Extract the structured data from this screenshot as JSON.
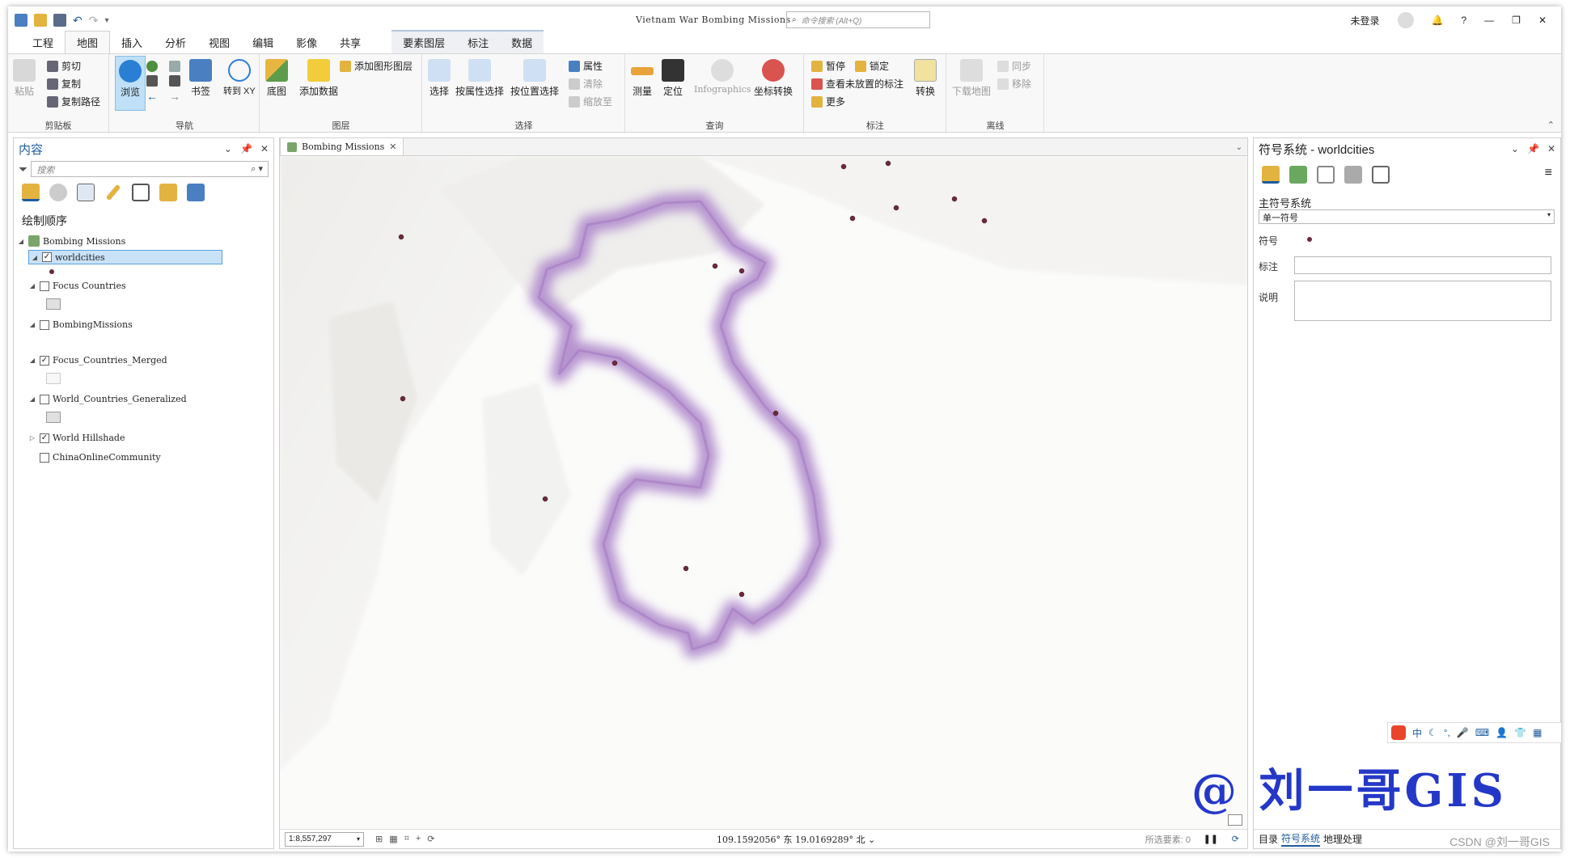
{
  "window": {
    "title": "Vietnam War Bombing Missions",
    "command_search_placeholder": "命令搜索 (Alt+Q)",
    "user_status": "未登录",
    "help": "?"
  },
  "ribbon_tabs": [
    "工程",
    "地图",
    "插入",
    "分析",
    "视图",
    "编辑",
    "影像",
    "共享"
  ],
  "active_tab": "地图",
  "context_tabs": [
    "要素图层",
    "标注",
    "数据"
  ],
  "ribbon": {
    "clipboard": {
      "label": "剪贴板",
      "paste": "粘贴",
      "cut": "剪切",
      "copy": "复制",
      "copy_path": "复制路径"
    },
    "navigate": {
      "label": "导航",
      "explore": "浏览",
      "bookmarks": "书签",
      "goto_xy": "转到 XY"
    },
    "layer": {
      "label": "图层",
      "basemap": "底图",
      "add_data": "添加数据",
      "add_graphics_layer": "添加图形图层"
    },
    "selection": {
      "label": "选择",
      "select": "选择",
      "select_by_attributes": "按属性选择",
      "select_by_location": "按位置选择",
      "attributes": "属性",
      "clear": "清除",
      "zoom_to": "缩放至"
    },
    "inquiry": {
      "label": "查询",
      "measure": "测量",
      "locate": "定位",
      "infographics": "Infographics",
      "coordinate_conversion": "坐标转换"
    },
    "labeling": {
      "label": "标注",
      "pause": "暂停",
      "lock": "锁定",
      "view_unplaced": "查看未放置的标注",
      "more": "更多",
      "convert": "转换"
    },
    "offline": {
      "label": "离线",
      "download_map": "下载地图",
      "sync": "同步",
      "remove": "移除"
    }
  },
  "contents": {
    "title": "内容",
    "search_placeholder": "搜索",
    "drawing_order": "绘制顺序",
    "map_name": "Bombing Missions",
    "layers": [
      {
        "name": "worldcities",
        "checked": true,
        "selected": true
      },
      {
        "name": "Focus Countries",
        "checked": false
      },
      {
        "name": "BombingMissions",
        "checked": false
      },
      {
        "name": "Focus_Countries_Merged",
        "checked": true
      },
      {
        "name": "World_Countries_Generalized",
        "checked": false
      },
      {
        "name": "World Hillshade",
        "checked": true
      },
      {
        "name": "ChinaOnlineCommunity",
        "checked": false
      }
    ]
  },
  "map": {
    "tab_name": "Bombing Missions",
    "scale": "1:8,557,297",
    "coordinates": "109.1592056° 东 19.0169289° 北",
    "selected_features": "所选要素: 0",
    "city_color": "#6b2a3a",
    "highlight_color": "#b28fcc"
  },
  "symbology": {
    "title": "符号系统 - worldcities",
    "primary": "主符号系统",
    "method": "单一符号",
    "symbol_label": "符号",
    "label_label": "标注",
    "description_label": "说明"
  },
  "bottom_tabs": [
    "目录",
    "符号系统",
    "地理处理"
  ],
  "active_bottom_tab": "符号系统",
  "ime": {
    "label": "中"
  },
  "watermark": "@ 刘一哥GIS",
  "csdn_credit": "CSDN @刘一哥GIS"
}
